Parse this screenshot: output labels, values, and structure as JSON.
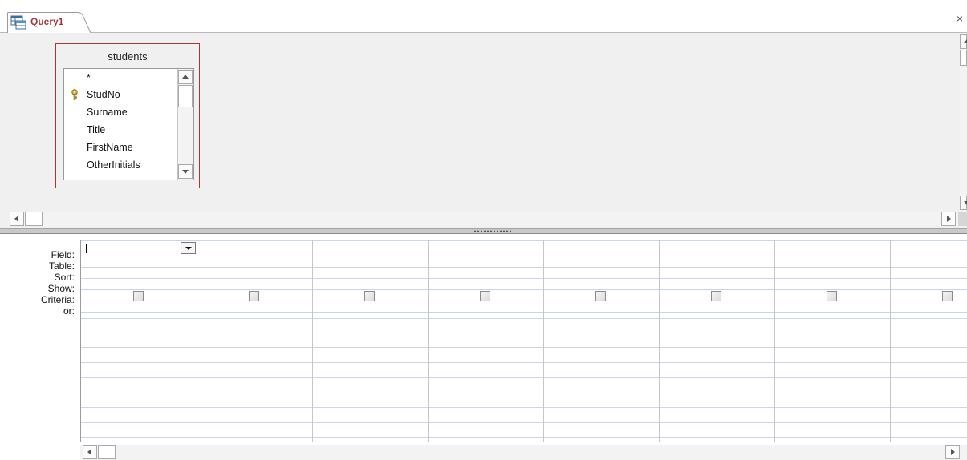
{
  "document_tab": {
    "title": "Query1",
    "icon": "query-design-icon"
  },
  "close_glyph": "×",
  "table": {
    "name": "students",
    "fields": [
      "*",
      "StudNo",
      "Surname",
      "Title",
      "FirstName",
      "OtherInitials"
    ],
    "primary_key": "StudNo"
  },
  "grid": {
    "row_labels": [
      "Field:",
      "Table:",
      "Sort:",
      "Show:",
      "Criteria:",
      "or:"
    ],
    "column_count": 8
  },
  "colors": {
    "accent": "#a4373a",
    "pane_bg": "#f0f0f0",
    "grid_line": "#c9d4e4"
  }
}
